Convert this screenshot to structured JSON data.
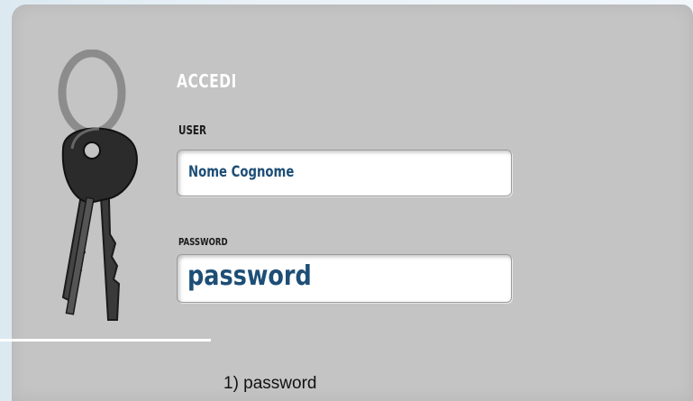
{
  "login": {
    "title": "ACCEDI",
    "user_label": "USER",
    "user_value": "Nome Cognome",
    "password_label": "PASSWORD",
    "password_value": "password"
  },
  "caption": "1) password",
  "icons": {
    "illustration": "keys-icon"
  },
  "colors": {
    "panel": "#c4c4c4",
    "field_text": "#1d4e76",
    "title": "#ffffff"
  }
}
